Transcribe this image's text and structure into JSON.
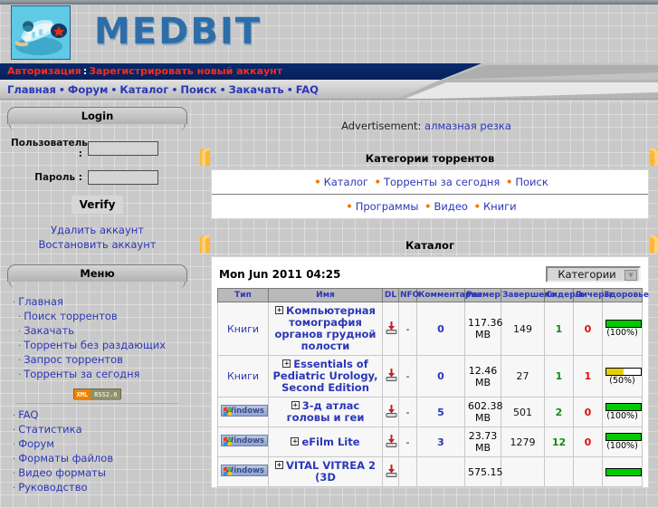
{
  "site": {
    "brand": "MEDBIT",
    "logo_icon": "medical-illustration-logo"
  },
  "authbar": {
    "login_label": "Авторизация",
    "separator": ":",
    "register_label": "Зарегистрировать новый аккаунт"
  },
  "nav": {
    "items": [
      "Главная",
      "Форум",
      "Каталог",
      "Поиск",
      "Закачать",
      "FAQ"
    ],
    "separator": "•"
  },
  "sidebar": {
    "login_panel": {
      "title": "Login",
      "username_label": "Пользователь :",
      "username_value": "",
      "password_label": "Пароль :",
      "password_value": "",
      "verify_label": "Verify",
      "links": [
        "Удалить аккаунт",
        "Востановить аккаунт"
      ]
    },
    "menu_panel": {
      "title": "Меню",
      "bullet": "·",
      "items": [
        "Главная",
        "Поиск торрентов",
        "Закачать",
        "Торренты без раздающих",
        "Запрос торрентов",
        "Торренты за сегодня"
      ],
      "rss": {
        "xml_label": "XML",
        "rss_label": "RSS2.0"
      },
      "items2": [
        "FAQ",
        "Статистика",
        "Форум",
        "Форматы файлов",
        "Видео форматы",
        "Руководство"
      ]
    }
  },
  "content": {
    "ad": {
      "prefix": "Advertisement:",
      "link": "алмазная резка"
    },
    "categories_section": {
      "title": "Категории торрентов",
      "rows": [
        [
          "Каталог",
          "Торренты за сегодня",
          "Поиск"
        ],
        [
          "Программы",
          "Видео",
          "Книги"
        ]
      ],
      "bullet": "•"
    },
    "catalog_section": {
      "title": "Каталог",
      "date": "Mon Jun 2011 04:25",
      "category_select": {
        "value": "Категории",
        "arrow": "▼"
      },
      "columns": [
        "Тип",
        "Имя",
        "DL",
        "NFO",
        "Комментарии",
        "Размер",
        "Завершено",
        "Сидеры",
        "Личеры",
        "Здоровье"
      ],
      "rows": [
        {
          "type": "Книги",
          "type_kind": "text",
          "name": "Компьютерная томография органов грудной полости",
          "dl": "download-icon",
          "nfo": "-",
          "comments": "0",
          "size": "117.36 MB",
          "completed": "149",
          "seeders": "1",
          "leechers": "0",
          "health_pct": 100,
          "health_label": "(100%)",
          "health_color": "#00cc00"
        },
        {
          "type": "Книги",
          "type_kind": "text",
          "name": "Essentials of Pediatric Urology, Second Edition",
          "dl": "download-icon",
          "nfo": "-",
          "comments": "0",
          "size": "12.46 MB",
          "completed": "27",
          "seeders": "1",
          "leechers": "1",
          "health_pct": 50,
          "health_label": "(50%)",
          "health_color": "#e8d000"
        },
        {
          "type": "Windows",
          "type_kind": "windows",
          "name": "3-д атлас головы и геи",
          "dl": "download-icon",
          "nfo": "-",
          "comments": "5",
          "size": "602.38 MB",
          "completed": "501",
          "seeders": "2",
          "leechers": "0",
          "health_pct": 100,
          "health_label": "(100%)",
          "health_color": "#00cc00"
        },
        {
          "type": "Windows",
          "type_kind": "windows",
          "name": "eFilm Lite",
          "dl": "download-icon",
          "nfo": "-",
          "comments": "3",
          "size": "23.73 MB",
          "completed": "1279",
          "seeders": "12",
          "leechers": "0",
          "health_pct": 100,
          "health_label": "(100%)",
          "health_color": "#00cc00"
        },
        {
          "type": "Windows",
          "type_kind": "windows",
          "name": "VITAL VITREA 2 (3D",
          "dl": "download-icon",
          "nfo": "",
          "comments": "",
          "size": "575.15",
          "completed": "",
          "seeders": "",
          "leechers": "",
          "health_pct": 100,
          "health_label": "",
          "health_color": "#00cc00"
        }
      ]
    }
  },
  "colors": {
    "brand_blue": "#2d6ea8",
    "link_blue": "#2b37b7",
    "auth_red": "#ff2a1a",
    "accent_orange": "#f07800",
    "health_green": "#00cc00",
    "health_yellow": "#e8d000"
  }
}
